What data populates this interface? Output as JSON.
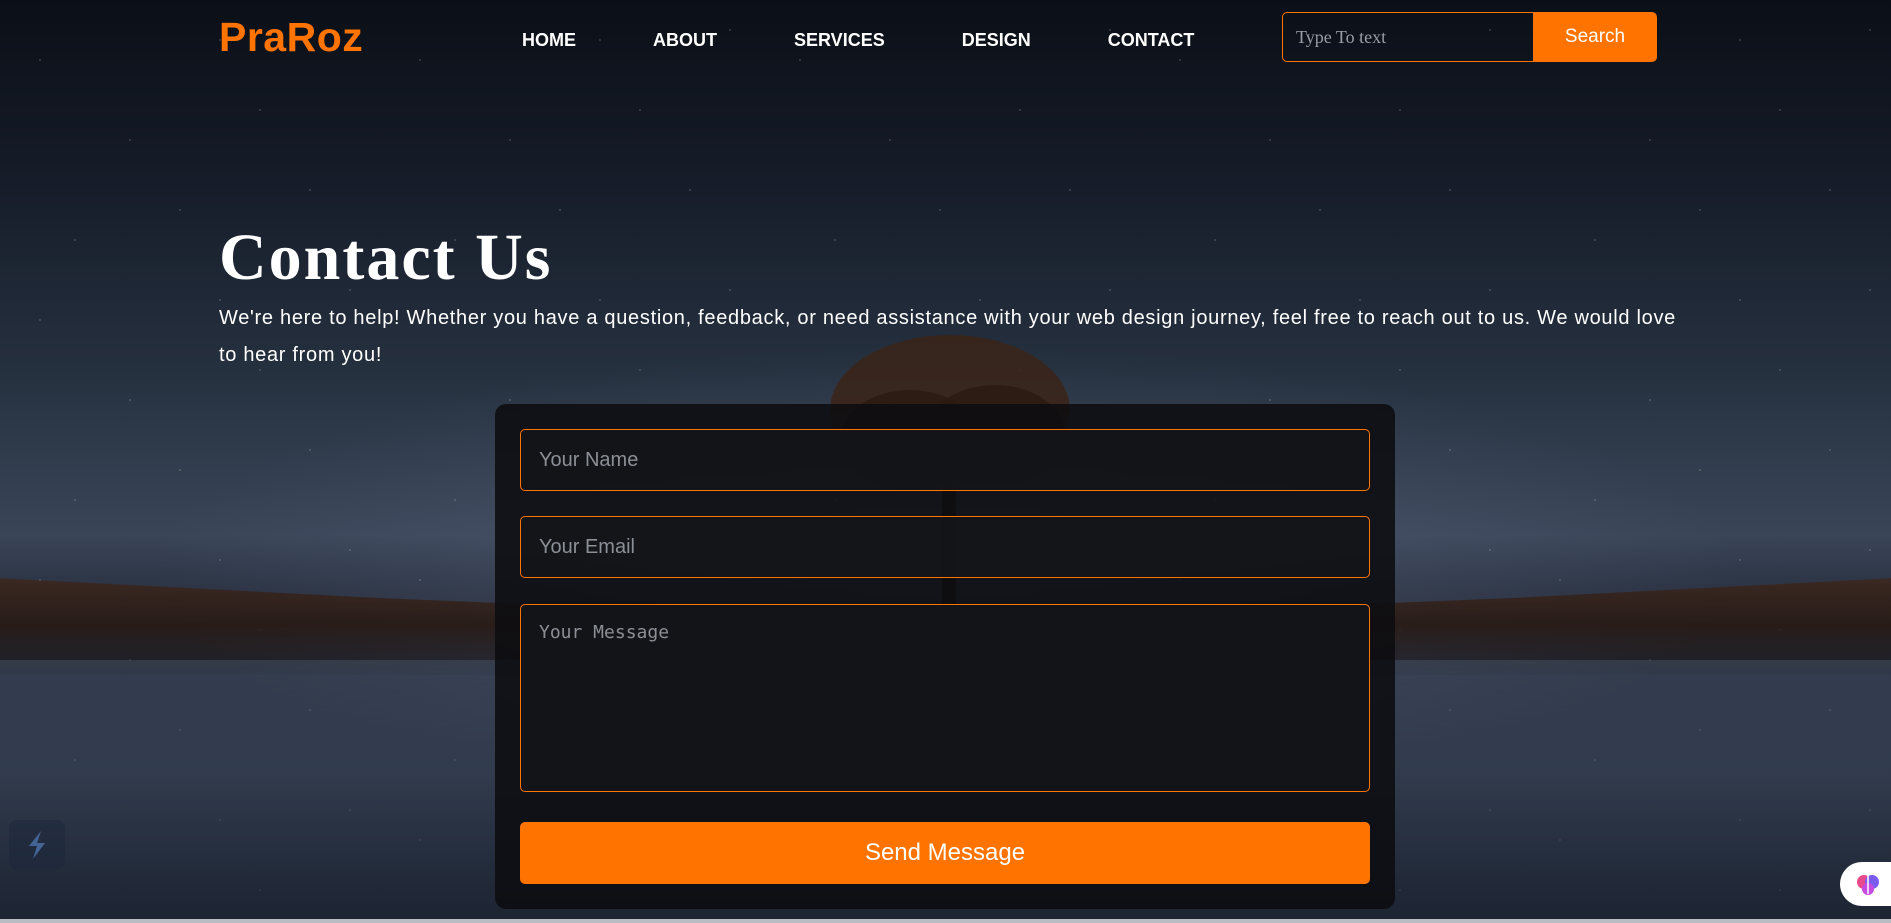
{
  "brand": {
    "logo": "PraRoz",
    "accent_color": "#ff7300"
  },
  "nav": {
    "items": [
      {
        "label": "HOME"
      },
      {
        "label": "ABOUT"
      },
      {
        "label": "SERVICES"
      },
      {
        "label": "DESIGN"
      },
      {
        "label": "CONTACT"
      }
    ]
  },
  "search": {
    "placeholder": "Type To text",
    "button_label": "Search"
  },
  "hero": {
    "title": "Contact Us",
    "intro": "We're here to help! Whether you have a question, feedback, or need assistance with your web design journey, feel free to reach out to us. We would love to hear from you!"
  },
  "form": {
    "name_placeholder": "Your Name",
    "email_placeholder": "Your Email",
    "message_placeholder": "Your Message",
    "submit_label": "Send Message"
  },
  "widgets": {
    "left_icon": "lightning-icon",
    "right_icon": "brain-icon"
  }
}
